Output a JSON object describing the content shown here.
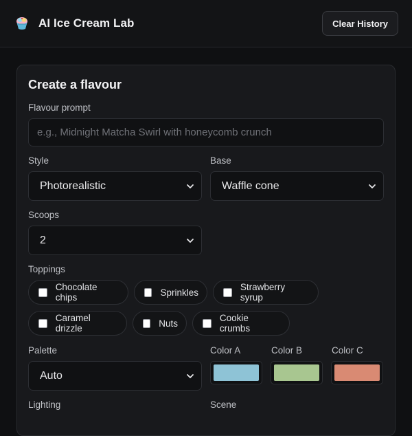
{
  "header": {
    "title": "AI Ice Cream Lab",
    "clear_button": "Clear History",
    "icon": "ice-cream-icon"
  },
  "form": {
    "title": "Create a flavour",
    "prompt": {
      "label": "Flavour prompt",
      "placeholder": "e.g., Midnight Matcha Swirl with honeycomb crunch",
      "value": ""
    },
    "style": {
      "label": "Style",
      "value": "Photorealistic"
    },
    "base": {
      "label": "Base",
      "value": "Waffle cone"
    },
    "scoops": {
      "label": "Scoops",
      "value": "2"
    },
    "toppings": {
      "label": "Toppings",
      "items": [
        {
          "label": "Chocolate chips",
          "checked": false
        },
        {
          "label": "Sprinkles",
          "checked": false
        },
        {
          "label": "Strawberry syrup",
          "checked": false
        },
        {
          "label": "Caramel drizzle",
          "checked": false
        },
        {
          "label": "Nuts",
          "checked": false
        },
        {
          "label": "Cookie crumbs",
          "checked": false
        }
      ]
    },
    "palette": {
      "label": "Palette",
      "value": "Auto"
    },
    "colors": [
      {
        "label": "Color A",
        "value": "#8ec3d6"
      },
      {
        "label": "Color B",
        "value": "#a8c690"
      },
      {
        "label": "Color C",
        "value": "#d98a73"
      }
    ],
    "lighting": {
      "label": "Lighting"
    },
    "scene": {
      "label": "Scene"
    }
  },
  "theme": {
    "background": "#0f1012",
    "card": "#18191c",
    "field": "#101113"
  }
}
